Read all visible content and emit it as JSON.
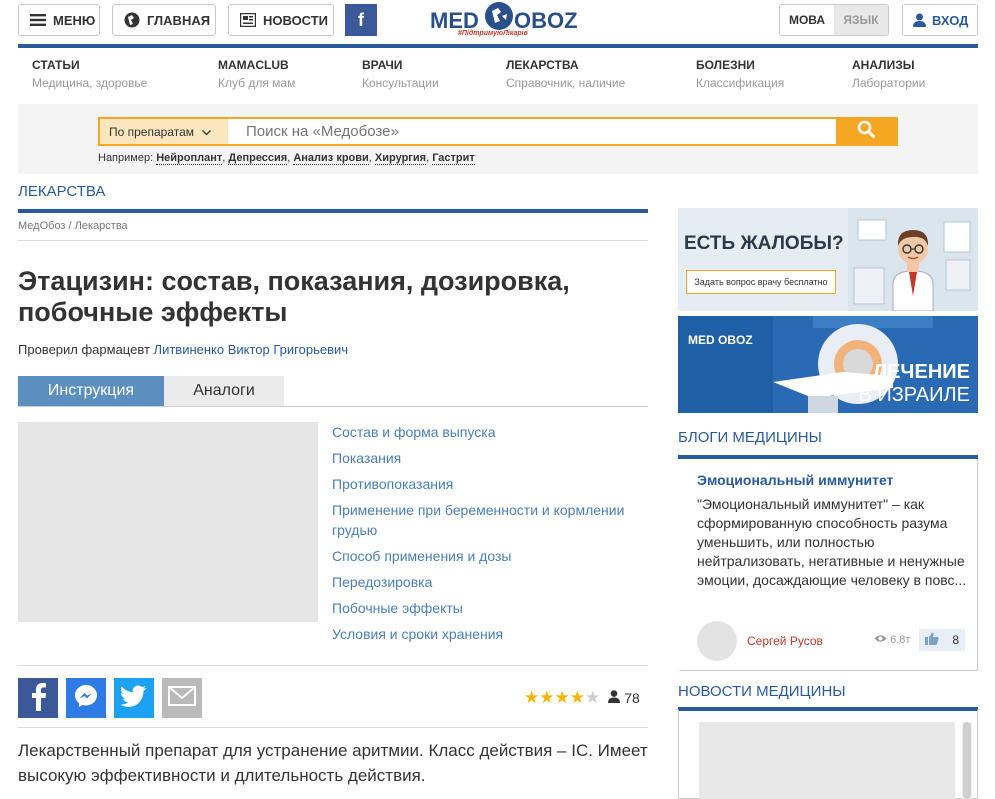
{
  "topbar": {
    "menu_label": "МЕНЮ",
    "home_label": "ГЛАВНАЯ",
    "news_label": "НОВОСТИ",
    "facebook_glyph": "f",
    "logo_left": "MED",
    "logo_right": "OBOZ",
    "logo_tag": "#ПідтримуюЛікарів",
    "lang_uk": "МОВА",
    "lang_ru": "ЯЗЫК",
    "login_label": "ВХОД"
  },
  "nav": [
    {
      "title": "СТАТЬИ",
      "sub": "Медицина, здоровье"
    },
    {
      "title": "MAMACLUB",
      "sub": "Клуб для мам"
    },
    {
      "title": "ВРАЧИ",
      "sub": "Консультации"
    },
    {
      "title": "ЛЕКАРСТВА",
      "sub": "Справочник, наличие"
    },
    {
      "title": "БОЛЕЗНИ",
      "sub": "Классификация"
    },
    {
      "title": "АНАЛИЗЫ",
      "sub": "Лаборатории"
    }
  ],
  "search": {
    "category": "По препаратам",
    "placeholder": "Поиск на «Медобозе»",
    "examples_prefix": "Например:",
    "examples": [
      "Нейроплант",
      "Депрессия",
      "Анализ крови",
      "Хирургия",
      "Гастрит"
    ]
  },
  "section_title": "ЛЕКАРСТВА",
  "breadcrumb": {
    "items": [
      "МедОбоз",
      "Лекарства"
    ],
    "sep": "/"
  },
  "article": {
    "title": "Этацизин: состав, показания, дозировка, побочные эффекты",
    "checked_prefix": "Проверил фармацевт",
    "checked_by": "Литвиненко Виктор Григорьевич",
    "tabs": [
      "Инструкция",
      "Аналоги"
    ],
    "toc": [
      "Состав и форма выпуска",
      "Показания",
      "Противопоказания",
      "Применение при беременности и кормлении грудью",
      "Способ применения и дозы",
      "Передозировка",
      "Побочные эффекты",
      "Условия и сроки хранения"
    ],
    "rating": {
      "stars": 4,
      "max": 5,
      "count": "78"
    },
    "lead": "Лекарственный препарат для устранение аритмии. Класс действия – IC. Имеет высокую эффективности и длительность действия."
  },
  "sidebar": {
    "ad1": {
      "title": "ЕСТЬ ЖАЛОБЫ?",
      "button": "Задать вопрос врачу бесплатно"
    },
    "ad2": {
      "logo": "MED  OBOZ",
      "line1": "ЛЕЧЕНИЕ",
      "line2": "В ИЗРАИЛЕ"
    },
    "blogs_title": "БЛОГИ МЕДИЦИНЫ",
    "blog": {
      "title": "Эмоциональный иммунитет",
      "text": "\"Эмоциональный иммунитет\" – как сформированную способность разума уменьшить, или полностью нейтрализовать, негативные и ненужные эмоции, досаждающие человеку в повс...",
      "author": "Сергей Русов",
      "views": "6.8т",
      "likes": "8"
    },
    "news_title": "НОВОСТИ МЕДИЦИНЫ"
  },
  "colors": {
    "brand_blue": "#2a5a9a",
    "accent_orange": "#f5a623",
    "link_blue": "#4a7fb5"
  }
}
